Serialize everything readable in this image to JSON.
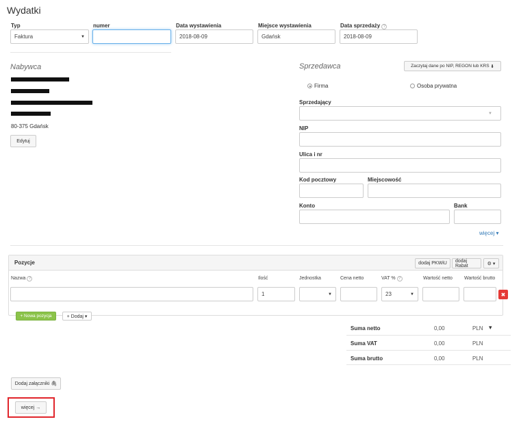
{
  "page": {
    "title": "Wydatki"
  },
  "header": {
    "typ_label": "Typ",
    "typ_value": "Faktura",
    "numer_label": "numer",
    "numer_value": "",
    "data_wyst_label": "Data wystawienia",
    "data_wyst_value": "2018-08-09",
    "miejsce_label": "Miejsce wystawienia",
    "miejsce_value": "Gdańsk",
    "data_sprz_label": "Data sprzedaży",
    "data_sprz_value": "2018-08-09",
    "help": "?"
  },
  "nabywca": {
    "title": "Nabywca",
    "city_line": "80-375 Gdańsk",
    "edit_label": "Edytuj"
  },
  "sprzedawca": {
    "title": "Sprzedawca",
    "fetch_button": "Zaczytaj dane po NIP, REGON lub KRS",
    "download_icon": "⬇",
    "radio_firma": "Firma",
    "radio_osoba": "Osoba prywatna",
    "sprzedajacy_label": "Sprzedający",
    "nip_label": "NIP",
    "ulica_label": "Ulica i nr",
    "kod_label": "Kod pocztowy",
    "miejscowosc_label": "Miejscowość",
    "konto_label": "Konto",
    "bank_label": "Bank",
    "wiecej_link": "więcej ▾"
  },
  "pozycje": {
    "title": "Pozycje",
    "pkwiu_button": "dodaj PKWiU",
    "rabat_button": "dodaj Rabat",
    "gear_icon": "⚙ ▾",
    "columns": {
      "nazwa": "Nazwa",
      "ilosc": "Ilość",
      "jednostka": "Jednostka",
      "cena": "Cena netto",
      "vat": "VAT %",
      "wartosc_netto": "Wartość netto",
      "wartosc_brutto": "Wartość brutto"
    },
    "row": {
      "nazwa": "",
      "ilosc": "1",
      "jednostka": "",
      "cena": "",
      "vat": "23",
      "netto": "",
      "brutto": ""
    },
    "delete_icon": "✖",
    "nowa_pozycja": "+ Nowa pozycja",
    "dodaj": "+ Dodaj ▾"
  },
  "summary": {
    "netto_label": "Suma netto",
    "netto_value": "0,00",
    "vat_label": "Suma VAT",
    "vat_value": "0,00",
    "brutto_label": "Suma brutto",
    "brutto_value": "0,00",
    "currency": "PLN",
    "currency_dropdown": "▾"
  },
  "footer": {
    "attach_label": "Dodaj załączniki",
    "attach_icon": "🖇",
    "wiecej_label": "więcej →"
  },
  "colors": {
    "accent": "#66afe9",
    "green": "#8bc34a",
    "red": "#e53935",
    "link": "#337ab7",
    "highlight": "#e0242a"
  }
}
